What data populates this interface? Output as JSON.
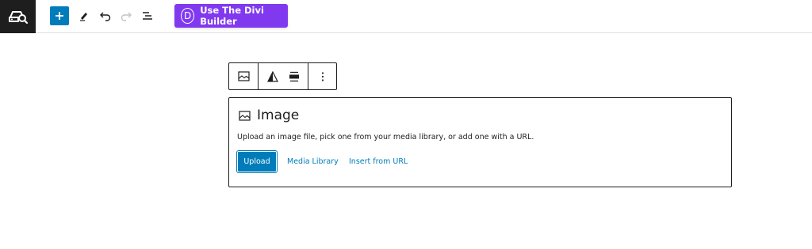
{
  "toolbar": {
    "logo_icon": "car-search-icon",
    "add_icon": "plus-icon",
    "tools_icon": "pencil-icon",
    "undo_icon": "undo-icon",
    "redo_icon": "redo-icon",
    "outline_icon": "list-view-icon",
    "divi_letter": "D",
    "divi_label": "Use The Divi Builder",
    "accent": "#007cba",
    "divi_color": "#8139f0"
  },
  "block_toolbar": {
    "transform_icon": "image-icon",
    "duotone_icon": "duotone-icon",
    "align_icon": "align-center-icon",
    "more_icon": "more-vertical-icon"
  },
  "image_block": {
    "icon": "image-icon",
    "title": "Image",
    "instructions": "Upload an image file, pick one from your media library, or add one with a URL.",
    "upload_label": "Upload",
    "media_library_label": "Media Library",
    "insert_url_label": "Insert from URL"
  }
}
